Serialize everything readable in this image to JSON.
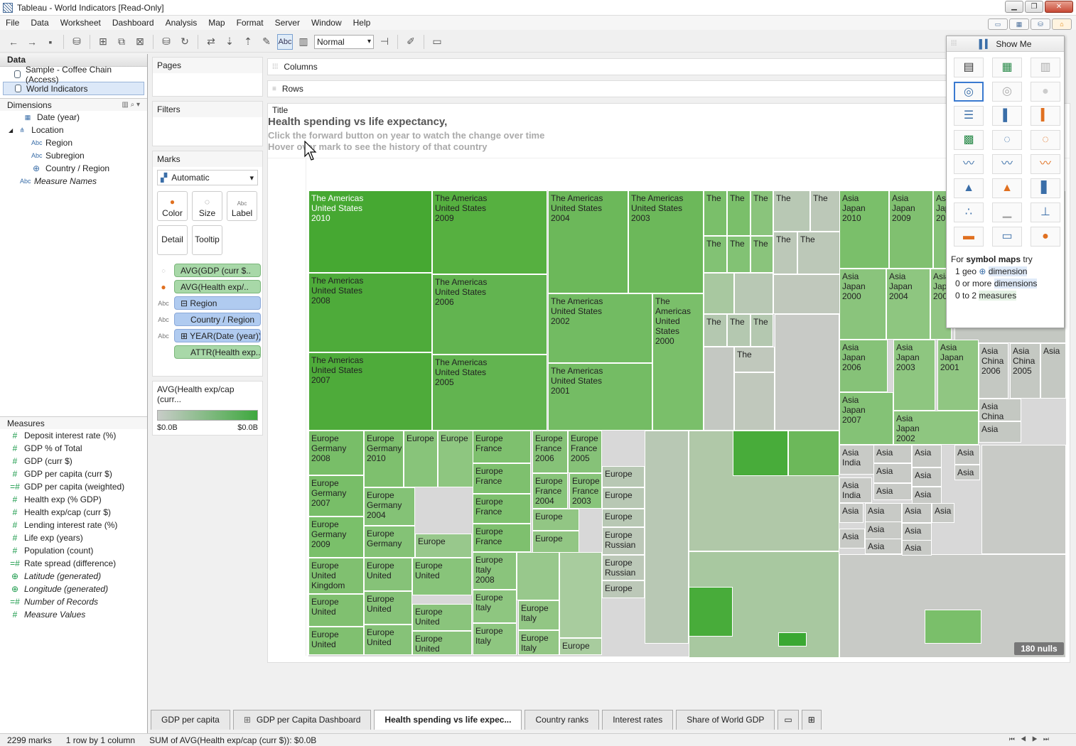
{
  "window": {
    "title": "Tableau - World Indicators [Read-Only]"
  },
  "menu": [
    "File",
    "Data",
    "Worksheet",
    "Dashboard",
    "Analysis",
    "Map",
    "Format",
    "Server",
    "Window",
    "Help"
  ],
  "toolbar": {
    "abc_label": "Abc",
    "fit_select": "Normal"
  },
  "data_pane": {
    "header": "Data",
    "sources": [
      "Sample - Coffee Chain (Access)",
      "World Indicators"
    ],
    "dimensions_header": "Dimensions",
    "dimensions": [
      {
        "label": "Date (year)",
        "icon": "calendar-icon"
      },
      {
        "label": "Location",
        "icon": "hierarchy-icon"
      },
      {
        "label": "Region",
        "icon": "abc-icon"
      },
      {
        "label": "Subregion",
        "icon": "abc-icon"
      },
      {
        "label": "Country / Region",
        "icon": "globe-icon"
      },
      {
        "label": "Measure Names",
        "icon": "abc-icon"
      }
    ],
    "measures_header": "Measures",
    "measures": [
      "Deposit interest rate (%)",
      "GDP % of Total",
      "GDP (curr $)",
      "GDP per capita (curr $)",
      "GDP per capita (weighted)",
      "Health exp (% GDP)",
      "Health exp/cap (curr $)",
      "Lending interest rate (%)",
      "Life exp (years)",
      "Population (count)",
      "Rate spread (difference)",
      "Latitude (generated)",
      "Longitude (generated)",
      "Number of Records",
      "Measure Values"
    ]
  },
  "shelves": {
    "pages": "Pages",
    "filters": "Filters",
    "columns": "Columns",
    "rows": "Rows"
  },
  "marks": {
    "header": "Marks",
    "type": "Automatic",
    "buttons": [
      "Color",
      "Size",
      "Label",
      "Detail",
      "Tooltip"
    ],
    "pills": [
      "AVG(GDP (curr $..",
      "AVG(Health exp/..",
      "Region",
      "Country / Region",
      "YEAR(Date (year))",
      "ATTR(Health exp.."
    ]
  },
  "legend": {
    "title": "AVG(Health exp/cap (curr...",
    "min": "$0.0B",
    "max": "$0.0B",
    "colors": [
      "#c8ccc8",
      "#3ea83e"
    ]
  },
  "viz": {
    "title_label": "Title",
    "title": "Health spending vs life expectancy,",
    "subtitle1": "Click the forward button on year to watch the change over time",
    "subtitle2": "Hover over mark to see the history of that country",
    "nulls": "180 nulls"
  },
  "treemap_cells": [
    {
      "t": [
        "The Americas",
        "United States",
        "2010"
      ],
      "c": "#46a832",
      "dk": true
    },
    {
      "t": [
        "The Americas",
        "United States",
        "2009"
      ],
      "c": "#56b040"
    },
    {
      "t": [
        "The Americas",
        "United States",
        "2004"
      ],
      "c": "#6cb85a"
    },
    {
      "t": [
        "The Americas",
        "United States",
        "2003"
      ],
      "c": "#6cb85a"
    },
    {
      "t": [
        "The Americas",
        "United States",
        "2008"
      ],
      "c": "#4eab3a"
    },
    {
      "t": [
        "The Americas",
        "United States",
        "2006"
      ],
      "c": "#62b450"
    },
    {
      "t": [
        "The Americas",
        "United States",
        "2002"
      ],
      "c": "#72bb62"
    },
    {
      "t": [
        "The Americas",
        "United States",
        "2000"
      ],
      "c": "#7abf6a"
    },
    {
      "t": [
        "The Americas",
        "United States",
        "2007"
      ],
      "c": "#4eab3a"
    },
    {
      "t": [
        "The Americas",
        "United States",
        "2005"
      ],
      "c": "#62b450"
    },
    {
      "t": [
        "The Americas",
        "United States",
        "2001"
      ],
      "c": "#74bc64"
    },
    {
      "t": [
        "The"
      ],
      "c": "#7abf6a"
    },
    {
      "t": [
        "The"
      ],
      "c": "#7abf6a"
    },
    {
      "t": [
        "The"
      ],
      "c": "#8ac47c"
    },
    {
      "t": [
        "The"
      ],
      "c": "#b8c8b4"
    },
    {
      "t": [
        "The"
      ],
      "c": "#bcc8b8"
    },
    {
      "t": [
        "The"
      ],
      "c": "#82c274"
    },
    {
      "t": [
        "The"
      ],
      "c": "#82c274"
    },
    {
      "t": [
        "The"
      ],
      "c": "#8ac47c"
    },
    {
      "t": [
        "The"
      ],
      "c": "#bcc8b8"
    },
    {
      "t": [
        "The"
      ],
      "c": "#bcc8b8"
    },
    {
      "t": [
        "The"
      ],
      "c": "#b4c8b0"
    },
    {
      "t": [
        "The"
      ],
      "c": "#b4c8b0"
    },
    {
      "t": [
        "The"
      ],
      "c": "#b4c8b0"
    },
    {
      "t": [
        "The"
      ],
      "c": "#c0c8bc"
    },
    {
      "t": [
        "Asia",
        "Japan",
        "2010"
      ],
      "c": "#7abf6a"
    },
    {
      "t": [
        "Asia",
        "Japan",
        "2009"
      ],
      "c": "#80c070"
    },
    {
      "t": [
        "Asia",
        "Japan",
        "20"
      ],
      "c": "#86c278"
    },
    {
      "t": [
        "Asia",
        "Japan",
        "2000"
      ],
      "c": "#8ac47c"
    },
    {
      "t": [
        "Asia",
        "Japan",
        "2004"
      ],
      "c": "#8ec680"
    },
    {
      "t": [
        "Asia",
        "Jap",
        "200"
      ],
      "c": "#92c684"
    },
    {
      "t": [
        "Asia",
        "Japan",
        "2006"
      ],
      "c": "#86c278"
    },
    {
      "t": [
        "Asia",
        "Japan",
        "2003"
      ],
      "c": "#8ec680"
    },
    {
      "t": [
        "Asia",
        "Japan",
        "2001"
      ],
      "c": "#90c682"
    },
    {
      "t": [
        "Asia",
        "China",
        "2006"
      ],
      "c": "#c4c8c2"
    },
    {
      "t": [
        "Asia",
        "China",
        "2005"
      ],
      "c": "#c4c8c2"
    },
    {
      "t": [
        "Asia"
      ],
      "c": "#c4c8c2"
    },
    {
      "t": [
        "Asia",
        "Japan",
        "2007"
      ],
      "c": "#84c276"
    },
    {
      "t": [
        "Asia",
        "Japan",
        "2002"
      ],
      "c": "#8ec680"
    },
    {
      "t": [
        "Asia",
        "China"
      ],
      "c": "#c4c8c2"
    },
    {
      "t": [
        "Asia"
      ],
      "c": "#c4c8c2"
    },
    {
      "t": [
        "Europe",
        "Germany",
        "2008"
      ],
      "c": "#78be68"
    },
    {
      "t": [
        "Europe",
        "Germany",
        "2010"
      ],
      "c": "#7ec06e"
    },
    {
      "t": [
        "Europe"
      ],
      "c": "#88c47a"
    },
    {
      "t": [
        "Europe"
      ],
      "c": "#8ec680"
    },
    {
      "t": [
        "Europe",
        "France"
      ],
      "c": "#7ec06e"
    },
    {
      "t": [
        "Europe",
        "France",
        "2006"
      ],
      "c": "#86c278"
    },
    {
      "t": [
        "Europe",
        "France",
        "2005"
      ],
      "c": "#86c278"
    },
    {
      "t": [
        "Europe",
        "Germany",
        "2007"
      ],
      "c": "#78be68"
    },
    {
      "t": [
        "Europe",
        "Germany",
        "2004"
      ],
      "c": "#84c276"
    },
    {
      "t": [
        "Europe",
        "France"
      ],
      "c": "#7ec06e"
    },
    {
      "t": [
        "Europe",
        "France",
        "2004"
      ],
      "c": "#88c47a"
    },
    {
      "t": [
        "Europe",
        "France",
        "2003"
      ],
      "c": "#88c47a"
    },
    {
      "t": [
        "Europe",
        "Germany",
        "2009"
      ],
      "c": "#7ac06a"
    },
    {
      "t": [
        "Europe",
        "Germany"
      ],
      "c": "#84c276"
    },
    {
      "t": [
        "Europe"
      ],
      "c": "#98c88c"
    },
    {
      "t": [
        "Europe",
        "France"
      ],
      "c": "#7ec06e"
    },
    {
      "t": [
        "Europe"
      ],
      "c": "#92c684"
    },
    {
      "t": [
        "Europe",
        "France"
      ],
      "c": "#7ec06e"
    },
    {
      "t": [
        "Europe"
      ],
      "c": "#92c684"
    },
    {
      "t": [
        "Europe",
        "United",
        "Kingdom"
      ],
      "c": "#80c070"
    },
    {
      "t": [
        "Europe",
        "United"
      ],
      "c": "#86c278"
    },
    {
      "t": [
        "Europe",
        "United"
      ],
      "c": "#88c47a"
    },
    {
      "t": [
        "Europe",
        "Italy",
        "2008"
      ],
      "c": "#8ac47c"
    },
    {
      "t": [
        "Europe",
        "United"
      ],
      "c": "#80c070"
    },
    {
      "t": [
        "Europe",
        "United"
      ],
      "c": "#86c278"
    },
    {
      "t": [
        "Europe",
        "United"
      ],
      "c": "#8ac47c"
    },
    {
      "t": [
        "Europe",
        "Italy"
      ],
      "c": "#8ec680"
    },
    {
      "t": [
        "Europe",
        "Italy"
      ],
      "c": "#92c684"
    },
    {
      "t": [
        "Europe",
        "United"
      ],
      "c": "#80c070"
    },
    {
      "t": [
        "Europe",
        "United"
      ],
      "c": "#86c278"
    },
    {
      "t": [
        "Europe",
        "United"
      ],
      "c": "#8ac47c"
    },
    {
      "t": [
        "Europe",
        "Italy"
      ],
      "c": "#8ec680"
    },
    {
      "t": [
        "Europe",
        "Italy"
      ],
      "c": "#92c684"
    },
    {
      "t": [
        "Europe"
      ],
      "c": "#a8cc9e"
    },
    {
      "t": [
        "Europe"
      ],
      "c": "#b8c8b4"
    },
    {
      "t": [
        "Europe"
      ],
      "c": "#b8c8b4"
    },
    {
      "t": [
        "Europe"
      ],
      "c": "#b8c8b4"
    },
    {
      "t": [
        "Europe",
        "Russian"
      ],
      "c": "#bcc8b8"
    },
    {
      "t": [
        "Europe",
        "Russian"
      ],
      "c": "#bcc8b8"
    },
    {
      "t": [
        "Europe"
      ],
      "c": "#bcc8b8"
    },
    {
      "t": [
        "Asia",
        "India"
      ],
      "c": "#c8cac6"
    },
    {
      "t": [
        "Asia"
      ],
      "c": "#c8cac6"
    },
    {
      "t": [
        "Asia"
      ],
      "c": "#c8cac6"
    },
    {
      "t": [
        "Asia"
      ],
      "c": "#c8cac6"
    },
    {
      "t": [
        "Asia"
      ],
      "c": "#c8cac6"
    },
    {
      "t": [
        "Asia"
      ],
      "c": "#c8cac6"
    },
    {
      "t": [
        "Asia"
      ],
      "c": "#c8cac6"
    },
    {
      "t": [
        "Asia",
        "India"
      ],
      "c": "#c8cac6"
    },
    {
      "t": [
        "Asia"
      ],
      "c": "#c8cac6"
    },
    {
      "t": [
        "Asia"
      ],
      "c": "#c8cac6"
    },
    {
      "t": [
        "Asia"
      ],
      "c": "#c8cac6"
    },
    {
      "t": [
        "Asia"
      ],
      "c": "#c8cac6"
    },
    {
      "t": [
        "Asia"
      ],
      "c": "#c8cac6"
    },
    {
      "t": [
        "Asia"
      ],
      "c": "#c8cac6"
    },
    {
      "t": [
        "Asia"
      ],
      "c": "#c8cac6"
    },
    {
      "t": [
        "Asia"
      ],
      "c": "#c8cac6"
    },
    {
      "t": [
        "Asia"
      ],
      "c": "#c8cac6"
    },
    {
      "t": [
        "Asia"
      ],
      "c": "#c8cac6"
    },
    {
      "t": [
        "Asia"
      ],
      "c": "#c8cac6"
    }
  ],
  "show_me": {
    "title": "Show Me",
    "hint_prefix": "For",
    "hint_chart": "symbol maps",
    "hint_suffix": "try",
    "req1_pre": "1 geo",
    "req1": "dimension",
    "req2_pre": "0 or more",
    "req2": "dimensions",
    "req3_pre": "0 to 2",
    "req3": "measures"
  },
  "tabs": [
    "GDP per capita",
    "GDP per Capita Dashboard",
    "Health spending vs life expec...",
    "Country ranks",
    "Interest rates",
    "Share of World GDP"
  ],
  "status": {
    "marks": "2299 marks",
    "rows": "1 row by 1 column",
    "sum": "SUM of AVG(Health exp/cap (curr $)): $0.0B"
  }
}
